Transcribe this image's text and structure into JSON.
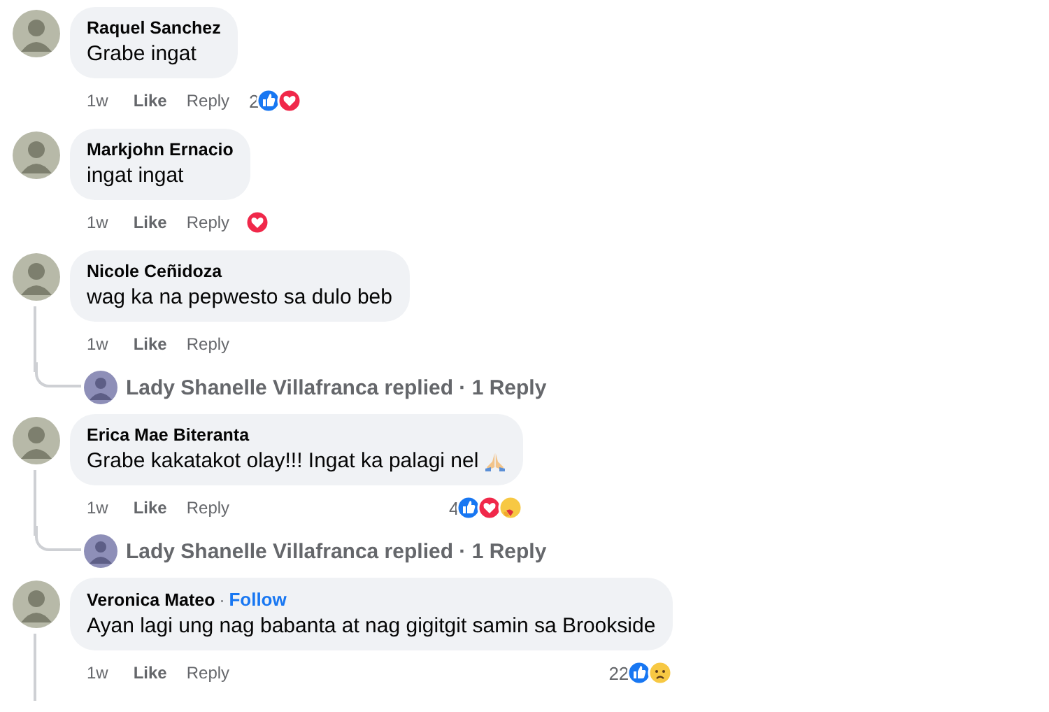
{
  "comments": [
    {
      "name": "Raquel Sanchez",
      "text": "Grabe ingat",
      "time": "1w",
      "like": "Like",
      "reply": "Reply",
      "reaction_count": "2",
      "reactions": [
        {
          "kind": "like"
        },
        {
          "kind": "love"
        }
      ],
      "thread": false
    },
    {
      "name": "Markjohn Ernacio",
      "text": "ingat ingat",
      "time": "1w",
      "like": "Like",
      "reply": "Reply",
      "reactions": [
        {
          "kind": "love"
        }
      ],
      "thread": false
    },
    {
      "name": "Nicole Ceñidoza",
      "text": "wag ka na pepwesto sa dulo beb",
      "time": "1w",
      "like": "Like",
      "reply": "Reply",
      "thread": true,
      "reply_summary": "Lady Shanelle Villafranca replied · 1 Reply"
    },
    {
      "name": "Erica Mae Biteranta",
      "text": "Grabe kakatakot olay!!! Ingat ka palagi nel",
      "emoji": {
        "kind": "pray"
      },
      "time": "1w",
      "like": "Like",
      "reply": "Reply",
      "reaction_count": "4",
      "reactions": [
        {
          "kind": "like"
        },
        {
          "kind": "love"
        },
        {
          "kind": "care"
        }
      ],
      "thread": true,
      "reply_summary": "Lady Shanelle Villafranca replied · 1 Reply"
    },
    {
      "name": "Veronica Mateo",
      "separator": "·",
      "follow": "Follow",
      "text": "Ayan lagi ung nag babanta at nag gigitgit samin sa Brookside",
      "time": "1w",
      "like": "Like",
      "reply": "Reply",
      "reaction_count": "22",
      "reactions": [
        {
          "kind": "like"
        },
        {
          "kind": "sad"
        }
      ],
      "thread": true
    }
  ]
}
